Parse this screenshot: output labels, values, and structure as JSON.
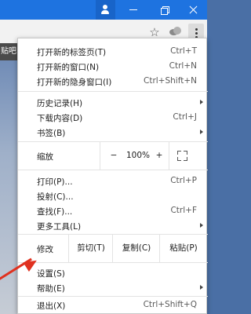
{
  "page": {
    "fragment_text": "贴吧"
  },
  "menu": {
    "new_tab": {
      "label": "打开新的标签页(T)",
      "shortcut": "Ctrl+T"
    },
    "new_window": {
      "label": "打开新的窗口(N)",
      "shortcut": "Ctrl+N"
    },
    "incognito": {
      "label": "打开新的隐身窗口(I)",
      "shortcut": "Ctrl+Shift+N"
    },
    "history": {
      "label": "历史记录(H)"
    },
    "downloads": {
      "label": "下载内容(D)",
      "shortcut": "Ctrl+J"
    },
    "bookmarks": {
      "label": "书签(B)"
    },
    "zoom": {
      "label": "缩放",
      "minus": "−",
      "value": "100%",
      "plus": "+"
    },
    "print": {
      "label": "打印(P)...",
      "shortcut": "Ctrl+P"
    },
    "cast": {
      "label": "投射(C)..."
    },
    "find": {
      "label": "查找(F)...",
      "shortcut": "Ctrl+F"
    },
    "more_tools": {
      "label": "更多工具(L)"
    },
    "edit": {
      "label": "修改",
      "cut": "剪切(T)",
      "copy": "复制(C)",
      "paste": "粘贴(P)"
    },
    "settings": {
      "label": "设置(S)"
    },
    "help": {
      "label": "帮助(E)"
    },
    "exit": {
      "label": "退出(X)",
      "shortcut": "Ctrl+Shift+Q"
    }
  },
  "colors": {
    "titlebar": "#1e73e0",
    "annotation_arrow": "#e0311f"
  },
  "icons": [
    "profile-icon",
    "minimize-icon",
    "restore-icon",
    "close-icon",
    "star-icon",
    "extension-icon",
    "menu-icon",
    "fullscreen-icon"
  ]
}
